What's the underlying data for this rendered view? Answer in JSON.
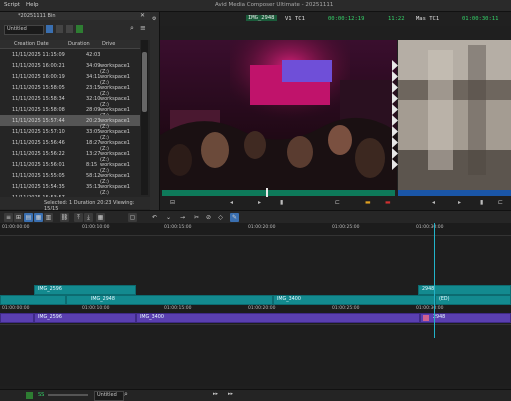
{
  "menubar": {
    "items": [
      "Script",
      "Help"
    ],
    "app_title": "Avid Media Composer Ultimate - 20251111"
  },
  "bin": {
    "title": "*20251111 Bin",
    "view_name": "Untitled",
    "columns": [
      "Creation Date",
      "Duration",
      "Drive"
    ],
    "rows": [
      {
        "date": "11/11/2025 11:15:09",
        "duration": "42:03",
        "drive": ""
      },
      {
        "date": "11/11/2025 16:00:21",
        "duration": "34:09",
        "drive": "workspace1 (Z:)"
      },
      {
        "date": "11/11/2025 16:00:19",
        "duration": "34:11",
        "drive": "workspace1 (Z:)"
      },
      {
        "date": "11/11/2025 15:58:05",
        "duration": "23:15",
        "drive": "workspace1 (Z:)"
      },
      {
        "date": "11/11/2025 15:58:34",
        "duration": "32:10",
        "drive": "workspace1 (Z:)"
      },
      {
        "date": "11/11/2025 15:58:08",
        "duration": "28:09",
        "drive": "workspace1 (Z:)"
      },
      {
        "date": "11/11/2025 15:57:44",
        "duration": "20:23",
        "drive": "workspace1 (Z:)"
      },
      {
        "date": "11/11/2025 15:57:10",
        "duration": "33:05",
        "drive": "workspace1 (Z:)"
      },
      {
        "date": "11/11/2025 15:56:46",
        "duration": "18:27",
        "drive": "workspace1 (Z:)"
      },
      {
        "date": "11/11/2025 15:56:22",
        "duration": "13:27",
        "drive": "workspace1 (Z:)"
      },
      {
        "date": "11/11/2025 15:56:01",
        "duration": "8:15",
        "drive": "workspace1 (Z:)"
      },
      {
        "date": "11/11/2025 15:55:05",
        "duration": "58:12",
        "drive": "workspace1 (Z:)"
      },
      {
        "date": "11/11/2025 15:54:35",
        "duration": "35:13",
        "drive": "workspace1 (Z:)"
      },
      {
        "date": "11/11/2025 15:53:57",
        "duration": "",
        "drive": ""
      }
    ],
    "status": "Selected: 1 Duration 20:23  Viewing: 15/15"
  },
  "monitors": {
    "source_clip": "IMG_2948",
    "v1": "V1",
    "tc1": "TC1",
    "source_tc": "00:00:12:19",
    "mid_tc": "11:22",
    "record_seq": "Mas TC1",
    "record_tc": "01:00:30:11"
  },
  "timeline": {
    "ruler": [
      "01:00:00:00",
      "01:00:10:00",
      "01:00:15:00",
      "01:00:20:00",
      "01:00:25:00",
      "01:00:30:00"
    ],
    "ruler2": [
      "01:00:00:00",
      "01:00:10:00",
      "01:00:15:00",
      "01:00:20:00",
      "01:00:25:00",
      "01:00:30:00"
    ],
    "clips": {
      "v3_a": "IMG_2596",
      "v3_b": "2948",
      "v2_a": "IMG_2948",
      "v2_b": "IMG_3400",
      "v2_c": "(ED)",
      "v1_a": "IMG_2596",
      "v1_b": "IMG_3400",
      "v1_c": "2948"
    },
    "bottom": {
      "view": "Untitled",
      "zoom": "SS"
    }
  }
}
